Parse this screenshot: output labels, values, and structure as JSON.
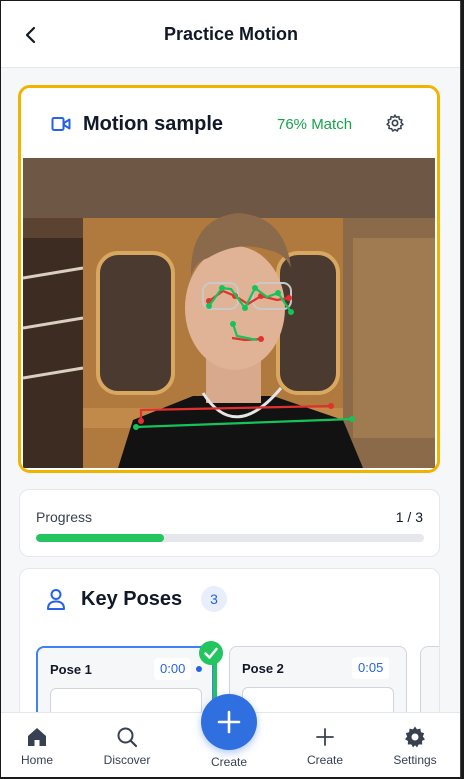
{
  "header": {
    "title": "Practice Motion",
    "back_icon": "chevron-left-icon"
  },
  "motion": {
    "title": "Motion sample",
    "match": "76% Match",
    "icons": [
      "video-icon",
      "gear-icon"
    ],
    "frame_color": "#f0b400",
    "match_color": "#16a34a"
  },
  "progress": {
    "label": "Progress",
    "count": "1 / 3",
    "value": 0.33,
    "bar_color": "#22c55e"
  },
  "key_poses": {
    "title": "Key Poses",
    "count": "3",
    "poses": [
      {
        "name": "Pose 1",
        "time": "0:00",
        "completed": true
      },
      {
        "name": "Pose 2",
        "time": "0:05",
        "completed": false
      }
    ]
  },
  "nav": {
    "items": [
      {
        "label": "Home",
        "icon": "home-icon"
      },
      {
        "label": "Discover",
        "icon": "search-icon"
      },
      {
        "label": "Create",
        "icon": "plus-icon"
      },
      {
        "label": "Create",
        "icon": "plus-icon"
      },
      {
        "label": "Settings",
        "icon": "gear-icon"
      }
    ],
    "accent": "#2f6fe0"
  }
}
